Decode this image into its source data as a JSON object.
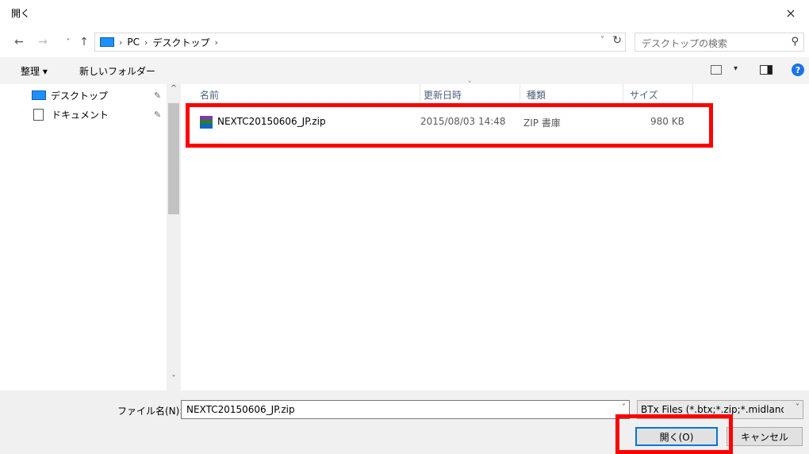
{
  "window": {
    "title": "開く",
    "close_glyph": "×"
  },
  "navigation": {
    "back_glyph": "←",
    "forward_glyph": "→",
    "recent_glyph": "˅",
    "up_glyph": "↑",
    "breadcrumb": [
      "PC",
      "デスクトップ"
    ],
    "separator": "›",
    "dropdown_glyph": "˅",
    "refresh_glyph": "↻",
    "search_placeholder": "デスクトップの検索",
    "search_glyph": "⚲"
  },
  "toolbar": {
    "organize_label": "整理 ▾",
    "new_folder_label": "新しいフォルダー",
    "view_dropdown_glyph": "▾",
    "help_glyph": "?"
  },
  "nav_pane": {
    "items": [
      {
        "label": "デスクトップ",
        "icon": "desktop-icon",
        "pinned": true
      },
      {
        "label": "ドキュメント",
        "icon": "document-icon",
        "pinned": true
      }
    ],
    "pin_glyph": "✎",
    "scroll_up_glyph": "^",
    "scroll_down_glyph": "˅"
  },
  "file_list": {
    "columns": [
      "名前",
      "更新日時",
      "種類",
      "サイズ"
    ],
    "sort_chevron": "˅",
    "files": [
      {
        "name": "NEXTC20150606_JP.zip",
        "modified": "2015/08/03 14:48",
        "type": "ZIP 書庫",
        "size": "980 KB",
        "icon": "zip-archive-icon"
      }
    ]
  },
  "bottom": {
    "filename_label": "ファイル名(N):",
    "filename_value": "NEXTC20150606_JP.zip",
    "filename_dropdown_glyph": "˅",
    "filter_value": "BTx Files (*.btx;*.zip;*.midlandfi",
    "filter_dropdown_glyph": "˅",
    "open_label": "開く(O)",
    "cancel_label": "キャンセル"
  },
  "colors": {
    "highlight": "#ff0000",
    "accent": "#0078d7",
    "desktop_icon": "#1e90ff"
  }
}
